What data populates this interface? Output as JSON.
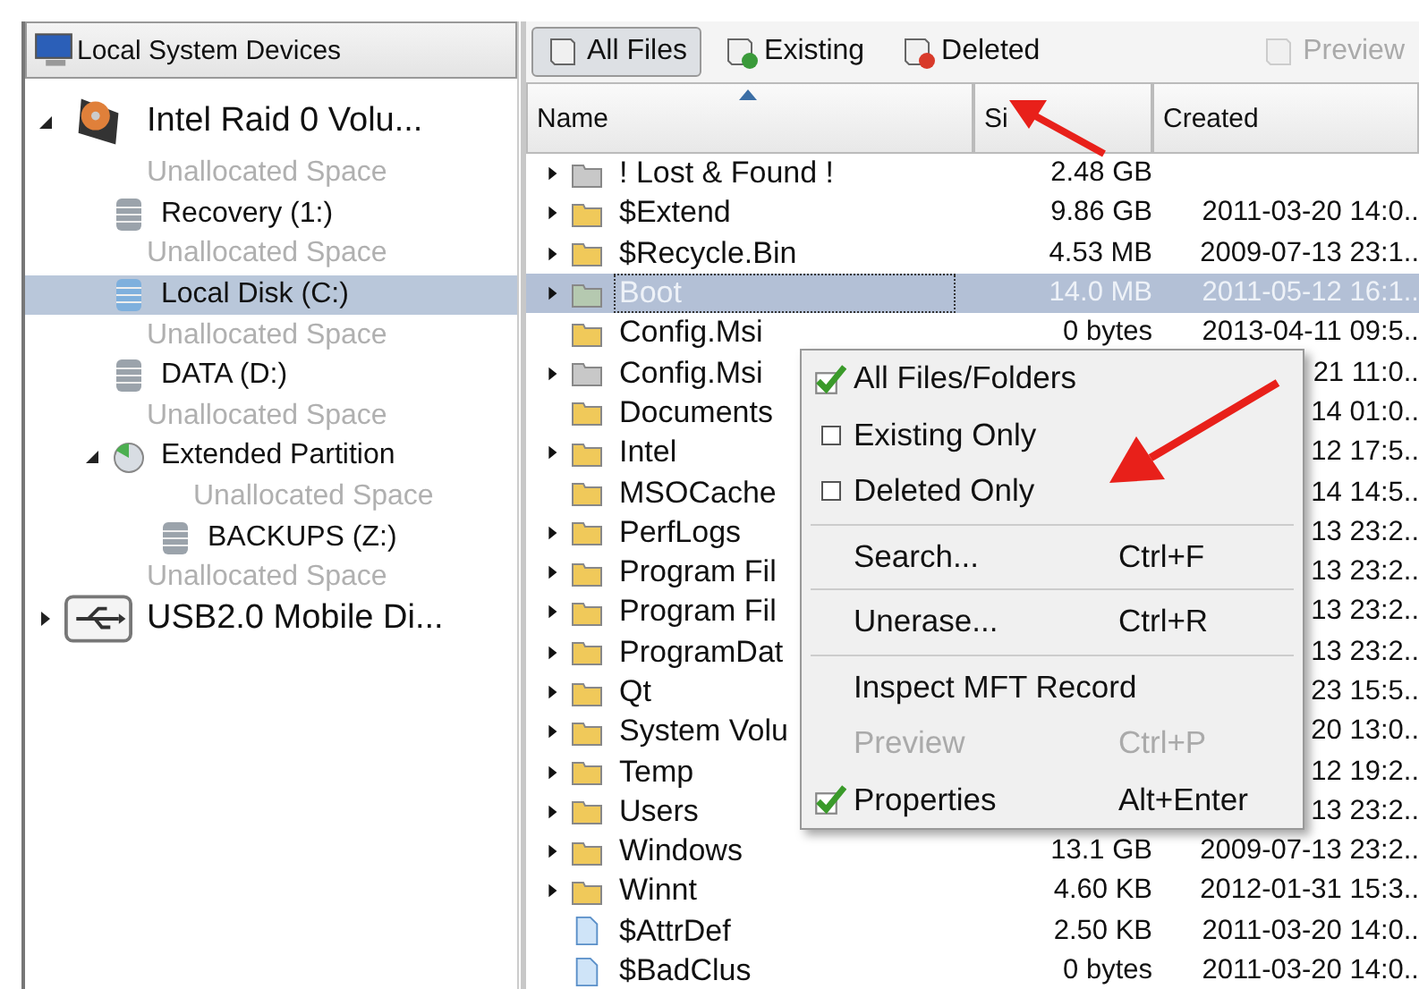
{
  "devices_panel": {
    "title": "Local System Devices",
    "tree": [
      {
        "label": "Intel   Raid 0 Volu...",
        "kind": "disk",
        "expanded": true,
        "selected": false,
        "children": [
          {
            "label": "Unallocated Space",
            "kind": "unallocated",
            "selected": false
          },
          {
            "label": "Recovery (1:)",
            "kind": "volume",
            "selected": false
          },
          {
            "label": "Unallocated Space",
            "kind": "unallocated",
            "selected": false
          },
          {
            "label": "Local Disk (C:)",
            "kind": "volume",
            "selected": true
          },
          {
            "label": "Unallocated Space",
            "kind": "unallocated",
            "selected": false
          },
          {
            "label": "DATA (D:)",
            "kind": "volume",
            "selected": false
          },
          {
            "label": "Unallocated Space",
            "kind": "unallocated",
            "selected": false
          },
          {
            "label": "Extended Partition",
            "kind": "partition",
            "expanded": true,
            "selected": false,
            "children": [
              {
                "label": "Unallocated Space",
                "kind": "unallocated",
                "selected": false
              },
              {
                "label": "BACKUPS (Z:)",
                "kind": "volume",
                "selected": false
              }
            ]
          },
          {
            "label": "Unallocated Space",
            "kind": "unallocated",
            "selected": false
          }
        ]
      },
      {
        "label": "USB2.0 Mobile Di...",
        "kind": "usb",
        "expanded": false,
        "selected": false
      }
    ]
  },
  "toolbar": [
    {
      "label": "All Files",
      "kind": "all",
      "selected": true,
      "disabled": false
    },
    {
      "label": "Existing",
      "kind": "existing",
      "selected": false,
      "disabled": false
    },
    {
      "label": "Deleted",
      "kind": "deleted",
      "selected": false,
      "disabled": false
    },
    {
      "label": "Preview",
      "kind": "preview",
      "selected": false,
      "disabled": true
    }
  ],
  "table": {
    "columns": [
      {
        "label": "Name",
        "sorted": true
      },
      {
        "label": "Si",
        "sorted": false
      },
      {
        "label": "Created",
        "sorted": false
      }
    ],
    "rows": [
      {
        "name": "! Lost & Found !",
        "kind": "grey-folder",
        "has_children": true,
        "selected": false,
        "size": "2.48 GB"
      },
      {
        "name": "$Extend",
        "kind": "folder",
        "has_children": true,
        "selected": false,
        "size": "9.86 GB",
        "created": "2011-03-20 14:0.."
      },
      {
        "name": "$Recycle.Bin",
        "kind": "folder",
        "has_children": true,
        "selected": false,
        "size": "4.53 MB",
        "created": "2009-07-13 23:1.."
      },
      {
        "name": "Boot",
        "kind": "grey-folder",
        "has_children": true,
        "selected": true,
        "size": "14.0 MB",
        "created": "2011-05-12 16:1.."
      },
      {
        "name": "Config.Msi",
        "kind": "folder",
        "has_children": false,
        "selected": false,
        "size": "0 bytes",
        "created": "2013-04-11 09:5.."
      },
      {
        "name": "Config.Msi",
        "kind": "grey-folder",
        "has_children": true,
        "selected": false,
        "created": "21 11:0.."
      },
      {
        "name": "Documents",
        "kind": "folder",
        "has_children": false,
        "selected": false,
        "created": "14 01:0.."
      },
      {
        "name": "Intel",
        "kind": "folder",
        "has_children": true,
        "selected": false,
        "created": "12 17:5.."
      },
      {
        "name": "MSOCache",
        "kind": "folder",
        "has_children": false,
        "selected": false,
        "created": "14 14:5.."
      },
      {
        "name": "PerfLogs",
        "kind": "folder",
        "has_children": true,
        "selected": false,
        "created": "13 23:2.."
      },
      {
        "name": "Program Fil",
        "kind": "folder",
        "has_children": true,
        "selected": false,
        "created": "13 23:2.."
      },
      {
        "name": "Program Fil",
        "kind": "folder",
        "has_children": true,
        "selected": false,
        "created": "13 23:2.."
      },
      {
        "name": "ProgramDat",
        "kind": "folder",
        "has_children": true,
        "selected": false,
        "created": "13 23:2.."
      },
      {
        "name": "Qt",
        "kind": "folder",
        "has_children": true,
        "selected": false,
        "created": "23 15:5.."
      },
      {
        "name": "System Volu",
        "kind": "folder",
        "has_children": true,
        "selected": false,
        "created": "20 13:0.."
      },
      {
        "name": "Temp",
        "kind": "folder",
        "has_children": true,
        "selected": false,
        "created": "12 19:2.."
      },
      {
        "name": "Users",
        "kind": "folder",
        "has_children": true,
        "selected": false,
        "created": "13 23:2.."
      },
      {
        "name": "Windows",
        "kind": "folder",
        "has_children": true,
        "selected": false,
        "size": "13.1 GB",
        "created": "2009-07-13 23:2.."
      },
      {
        "name": "Winnt",
        "kind": "folder",
        "has_children": true,
        "selected": false,
        "size": "4.60 KB",
        "created": "2012-01-31 15:3.."
      },
      {
        "name": "$AttrDef",
        "kind": "file",
        "has_children": false,
        "selected": false,
        "size": "2.50 KB",
        "created": "2011-03-20 14:0.."
      },
      {
        "name": "$BadClus",
        "kind": "file",
        "has_children": false,
        "selected": false,
        "size": "0 bytes",
        "created": "2011-03-20 14:0.."
      }
    ]
  },
  "context_menu": [
    {
      "kind": "toggle",
      "label": "All Files/Folders",
      "checked": true,
      "disabled": false
    },
    {
      "kind": "toggle",
      "label": "Existing Only",
      "checked": false,
      "disabled": false
    },
    {
      "kind": "toggle",
      "label": "Deleted Only",
      "checked": false,
      "disabled": false
    },
    {
      "kind": "separator"
    },
    {
      "kind": "command",
      "label": "Search...",
      "shortcut": "Ctrl+F",
      "checked": false,
      "disabled": false
    },
    {
      "kind": "separator"
    },
    {
      "kind": "command",
      "label": "Unerase...",
      "shortcut": "Ctrl+R",
      "checked": false,
      "disabled": false
    },
    {
      "kind": "separator"
    },
    {
      "kind": "command",
      "label": "Inspect MFT Record",
      "checked": false,
      "disabled": false
    },
    {
      "kind": "command",
      "label": "Preview",
      "shortcut": "Ctrl+P",
      "checked": false,
      "disabled": true
    },
    {
      "kind": "command",
      "label": "Properties",
      "shortcut": "Alt+Enter",
      "checked": true,
      "disabled": false
    }
  ]
}
